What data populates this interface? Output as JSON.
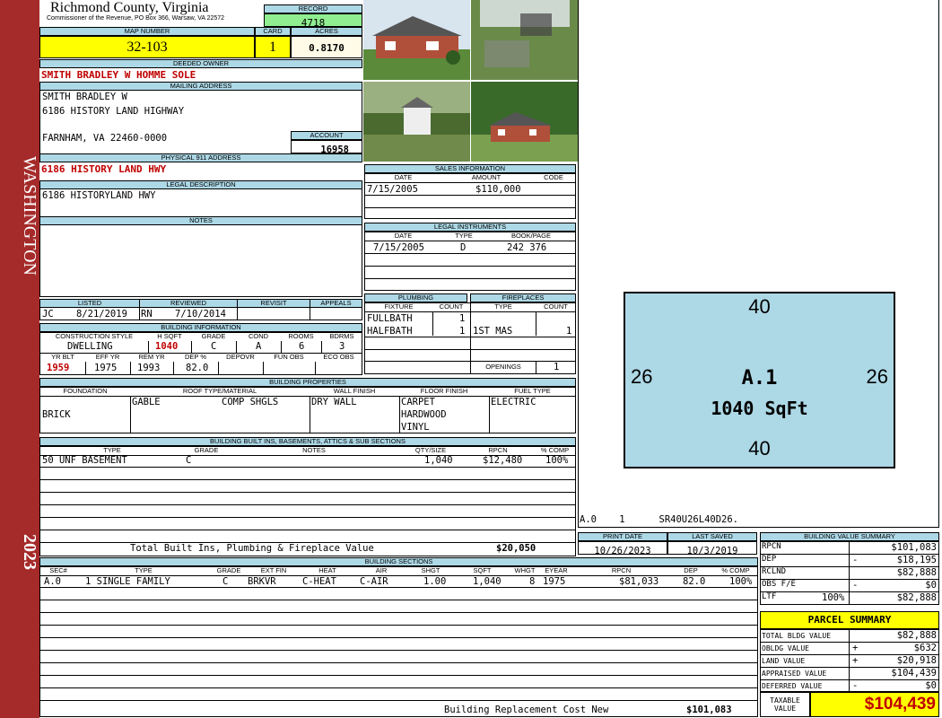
{
  "sidebar": {
    "district": "WASHINGTON",
    "year": "2023"
  },
  "header": {
    "county": "Richmond County, Virginia",
    "commissioner": "Commissioner of the Revenue, PO Box 366, Warsaw, VA 22572",
    "record_label": "RECORD",
    "record": "4718",
    "map_label": "MAP NUMBER",
    "map_number": "32-103",
    "card_label": "CARD",
    "card": "1",
    "acres_label": "ACRES",
    "acres": "0.8170"
  },
  "owner": {
    "deeded_label": "DEEDED OWNER",
    "deeded": "SMITH BRADLEY W HOMME SOLE",
    "mailing_label": "MAILING ADDRESS",
    "mailing": [
      "SMITH BRADLEY W",
      "6186 HISTORY LAND HIGHWAY",
      "",
      "FARNHAM, VA 22460-0000"
    ],
    "account_label": "ACCOUNT",
    "account": "16958",
    "physical_label": "PHYSICAL 911 ADDRESS",
    "physical": "6186 HISTORY LAND HWY",
    "legal_label": "LEGAL DESCRIPTION",
    "legal": "6186 HISTORYLAND HWY",
    "notes_label": "NOTES"
  },
  "sales": {
    "title": "SALES INFORMATION",
    "cols": [
      "DATE",
      "AMOUNT",
      "CODE"
    ],
    "rows": [
      [
        "7/15/2005",
        "$110,000",
        ""
      ]
    ]
  },
  "legal_instruments": {
    "title": "LEGAL INSTRUMENTS",
    "cols": [
      "DATE",
      "TYPE",
      "BOOK/PAGE"
    ],
    "rows": [
      [
        "7/15/2005",
        "D",
        "242 376"
      ]
    ]
  },
  "review": {
    "cols": [
      "LISTED",
      "REVIEWED",
      "REVISIT",
      "APPEALS"
    ],
    "listed_by": "JC",
    "listed": "8/21/2019",
    "reviewed_by": "RN",
    "reviewed": "7/10/2014"
  },
  "building_info": {
    "title": "BUILDING INFORMATION",
    "cols1": [
      "CONSTRUCTION STYLE",
      "H SQFT",
      "GRADE",
      "COND",
      "ROOMS",
      "BDRMS"
    ],
    "row1": [
      "DWELLING",
      "1040",
      "C",
      "A",
      "6",
      "3"
    ],
    "cols2": [
      "YR BLT",
      "EFF YR",
      "REM YR",
      "DEP %",
      "DEPOVR",
      "FUN OBS",
      "ECO OBS"
    ],
    "row2": [
      "1959",
      "1975",
      "1993",
      "82.0",
      "",
      "",
      ""
    ]
  },
  "plumbing": {
    "title": "PLUMBING",
    "cols": [
      "FIXTURE",
      "COUNT"
    ],
    "rows": [
      [
        "FULLBATH",
        "1"
      ],
      [
        "HALFBATH",
        "1"
      ]
    ]
  },
  "fireplaces": {
    "title": "FIREPLACES",
    "cols": [
      "TYPE",
      "COUNT"
    ],
    "rows": [
      [
        "1ST MAS",
        "1"
      ]
    ],
    "openings_label": "OPENINGS",
    "openings": "1"
  },
  "properties": {
    "title": "BUILDING PROPERTIES",
    "cols": [
      "FOUNDATION",
      "ROOF TYPE/MATERIAL",
      "WALL FINISH",
      "FLOOR FINISH",
      "FUEL TYPE"
    ],
    "foundation": "BRICK",
    "roof_type": "GABLE",
    "roof_material": "COMP SHGLS",
    "wall": "DRY WALL",
    "floor": [
      "CARPET",
      "HARDWOOD",
      "VINYL"
    ],
    "fuel": "ELECTRIC"
  },
  "builtins": {
    "title": "BUILDING BUILT INS, BASEMENTS, ATTICS & SUB SECTIONS",
    "cols": [
      "TYPE",
      "GRADE",
      "NOTES",
      "QTY/SIZE",
      "RPCN",
      "% COMP"
    ],
    "rows": [
      [
        "50 UNF BASEMENT",
        "C",
        "",
        "1,040",
        "$12,480",
        "100%"
      ]
    ],
    "total_label": "Total Built Ins, Plumbing & Fireplace Value",
    "total": "$20,050"
  },
  "sketch": {
    "top": "40",
    "bottom": "40",
    "left": "26",
    "right": "26",
    "label": "A.1",
    "area": "1040 SqFt",
    "code": "A.0    1      SR40U26L40D26."
  },
  "dates": {
    "print_label": "PRINT DATE",
    "print": "10/26/2023",
    "saved_label": "LAST SAVED",
    "saved": "10/3/2019"
  },
  "sections": {
    "title": "BUILDING SECTIONS",
    "cols": [
      "SEC#",
      "TYPE",
      "GRADE",
      "EXT FIN",
      "HEAT",
      "AIR",
      "SHGT",
      "SQFT",
      "WHGT",
      "EYEAR",
      "RPCN",
      "DEP",
      "% COMP"
    ],
    "rows": [
      [
        "A.0",
        "1 SINGLE FAMILY",
        "C",
        "BRKVR",
        "C-HEAT",
        "C-AIR",
        "1.00",
        "1,040",
        "8",
        "1975",
        "$81,033",
        "82.0",
        "100%"
      ]
    ],
    "total_label": "Building Replacement Cost New",
    "total": "$101,083"
  },
  "value_summary": {
    "title": "BUILDING VALUE SUMMARY",
    "rows": [
      {
        "label": "RPCN",
        "pct": "",
        "sign": "",
        "value": "$101,083"
      },
      {
        "label": "DEP",
        "pct": "",
        "sign": "-",
        "value": "$18,195"
      },
      {
        "label": "RCLND",
        "pct": "",
        "sign": "",
        "value": "$82,888"
      },
      {
        "label": "OBS F/E",
        "pct": "",
        "sign": "-",
        "value": "$0"
      },
      {
        "label": "LTF",
        "pct": "100%",
        "sign": "",
        "value": "$82,888"
      }
    ]
  },
  "parcel": {
    "title": "PARCEL SUMMARY",
    "rows": [
      {
        "label": "TOTAL BLDG VALUE",
        "sign": "",
        "value": "$82,888"
      },
      {
        "label": "OBLDG VALUE",
        "sign": "+",
        "value": "$632"
      },
      {
        "label": "LAND VALUE",
        "sign": "+",
        "value": "$20,918"
      },
      {
        "label": "APPRAISED VALUE",
        "sign": "",
        "value": "$104,439"
      },
      {
        "label": "DEFERRED VALUE",
        "sign": "-",
        "value": "$0"
      }
    ],
    "taxable_label": "TAXABLE VALUE",
    "taxable": "$104,439"
  },
  "colors": {
    "sidebar": "#a52a2a",
    "header_blue": "#add8e6",
    "yellow": "#ffff00",
    "record_green": "#90ee90",
    "sketch_fill": "#add8e6"
  }
}
